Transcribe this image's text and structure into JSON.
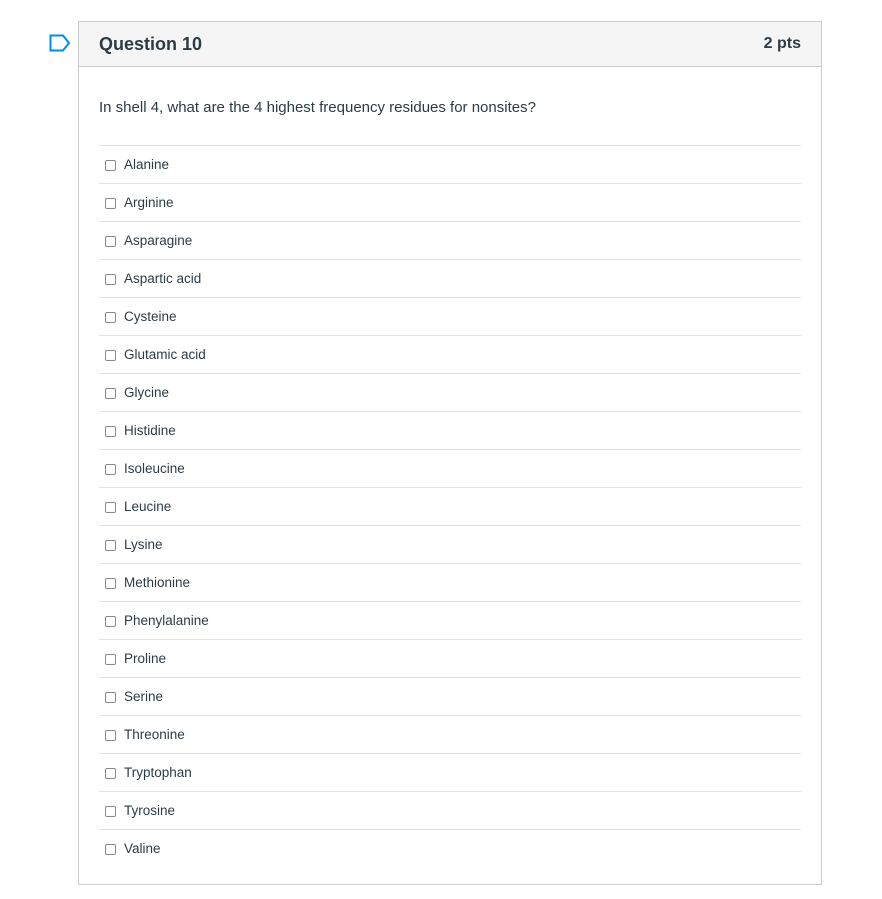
{
  "question": {
    "title": "Question 10",
    "points": "2 pts",
    "text": "In shell 4, what are the 4 highest frequency residues for nonsites?",
    "flag_icon": "bookmark-flag-icon"
  },
  "answers": [
    {
      "label": "Alanine",
      "checked": false
    },
    {
      "label": "Arginine",
      "checked": false
    },
    {
      "label": "Asparagine",
      "checked": false
    },
    {
      "label": "Aspartic acid",
      "checked": false
    },
    {
      "label": "Cysteine",
      "checked": false
    },
    {
      "label": "Glutamic acid",
      "checked": false
    },
    {
      "label": "Glycine",
      "checked": false
    },
    {
      "label": "Histidine",
      "checked": false
    },
    {
      "label": "Isoleucine",
      "checked": false
    },
    {
      "label": "Leucine",
      "checked": false
    },
    {
      "label": "Lysine",
      "checked": false
    },
    {
      "label": "Methionine",
      "checked": false
    },
    {
      "label": "Phenylalanine",
      "checked": false
    },
    {
      "label": "Proline",
      "checked": false
    },
    {
      "label": "Serine",
      "checked": false
    },
    {
      "label": "Threonine",
      "checked": false
    },
    {
      "label": "Tryptophan",
      "checked": false
    },
    {
      "label": "Tyrosine",
      "checked": false
    },
    {
      "label": "Valine",
      "checked": false
    }
  ],
  "colors": {
    "accent": "#008ee2",
    "header_bg": "#f5f5f5",
    "border": "#c7cdd1",
    "text": "#2d3b45"
  }
}
